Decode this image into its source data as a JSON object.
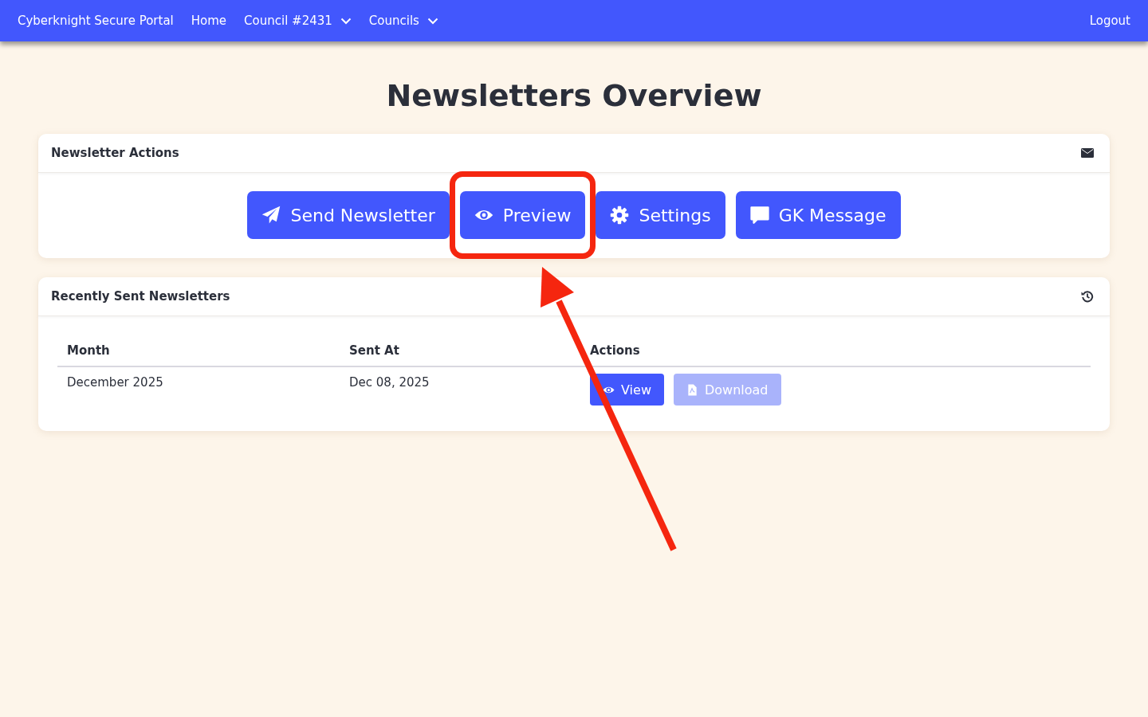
{
  "navbar": {
    "brand": "Cyberknight Secure Portal",
    "items": [
      {
        "label": "Home",
        "kind": "link"
      },
      {
        "label": "Council #2431",
        "kind": "dropdown"
      },
      {
        "label": "Councils",
        "kind": "dropdown"
      }
    ],
    "logout": "Logout"
  },
  "title": "Newsletters Overview",
  "actions_card": {
    "title": "Newsletter Actions",
    "buttons": [
      {
        "label": "Send Newsletter",
        "kind": "send",
        "highlighted": false
      },
      {
        "label": "Preview",
        "kind": "preview",
        "highlighted": true
      },
      {
        "label": "Settings",
        "kind": "settings",
        "highlighted": false
      },
      {
        "label": "GK Message",
        "kind": "message",
        "highlighted": false
      }
    ]
  },
  "recent_card": {
    "title": "Recently Sent Newsletters",
    "table": {
      "columns": [
        "Month",
        "Sent At",
        "Actions"
      ],
      "rows": [
        {
          "month": "December 2025",
          "sent_at": "Dec 08, 2025",
          "actions": [
            {
              "label": "View",
              "kind": "view",
              "disabled": false
            },
            {
              "label": "Download",
              "kind": "download",
              "disabled": true
            }
          ]
        }
      ]
    }
  }
}
